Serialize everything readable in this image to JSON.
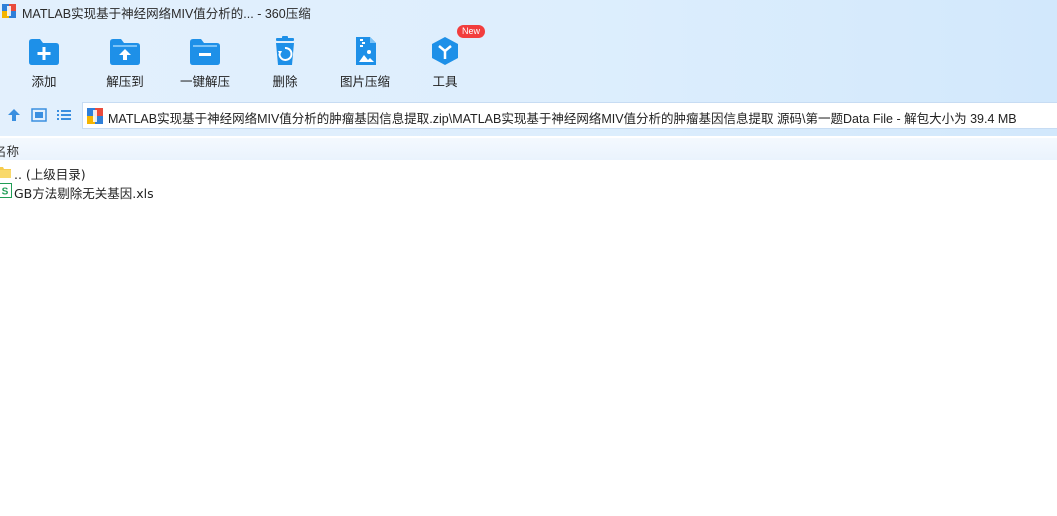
{
  "window": {
    "title": "MATLAB实现基于神经网络MIV值分析的... - 360压缩"
  },
  "toolbar": {
    "buttons": [
      {
        "id": "add",
        "label": "添加",
        "icon": "add-folder-icon"
      },
      {
        "id": "extract-to",
        "label": "解压到",
        "icon": "extract-folder-icon"
      },
      {
        "id": "one-click-extract",
        "label": "一键解压",
        "icon": "one-click-folder-icon"
      },
      {
        "id": "delete",
        "label": "删除",
        "icon": "recycle-bin-icon"
      },
      {
        "id": "image-compress",
        "label": "图片压缩",
        "icon": "image-zip-icon"
      },
      {
        "id": "tools",
        "label": "工具",
        "icon": "tools-cube-icon",
        "badge": "New"
      }
    ]
  },
  "navigation": {
    "buttons": [
      {
        "id": "up",
        "icon": "up-arrow-icon"
      },
      {
        "id": "thumbnail-view",
        "icon": "thumbnail-view-icon"
      },
      {
        "id": "list-view",
        "icon": "list-view-icon"
      }
    ],
    "address": "MATLAB实现基于神经网络MIV值分析的肿瘤基因信息提取.zip\\MATLAB实现基于神经网络MIV值分析的肿瘤基因信息提取 源码\\第一题Data File - 解包大小为 39.4 MB"
  },
  "file_list": {
    "columns": [
      {
        "label": "名称"
      }
    ],
    "rows": [
      {
        "name": ".. (上级目录)",
        "icon": "folder-icon"
      },
      {
        "name": "GB方法剔除无关基因.xls",
        "icon": "spreadsheet-icon"
      }
    ]
  },
  "colors": {
    "accent_blue": "#1e90e8",
    "top_band": "#ddeefd",
    "badge_red": "#f23d3d",
    "folder_yellow": "#f6cc4d",
    "sheet_green": "#1f9d55"
  }
}
